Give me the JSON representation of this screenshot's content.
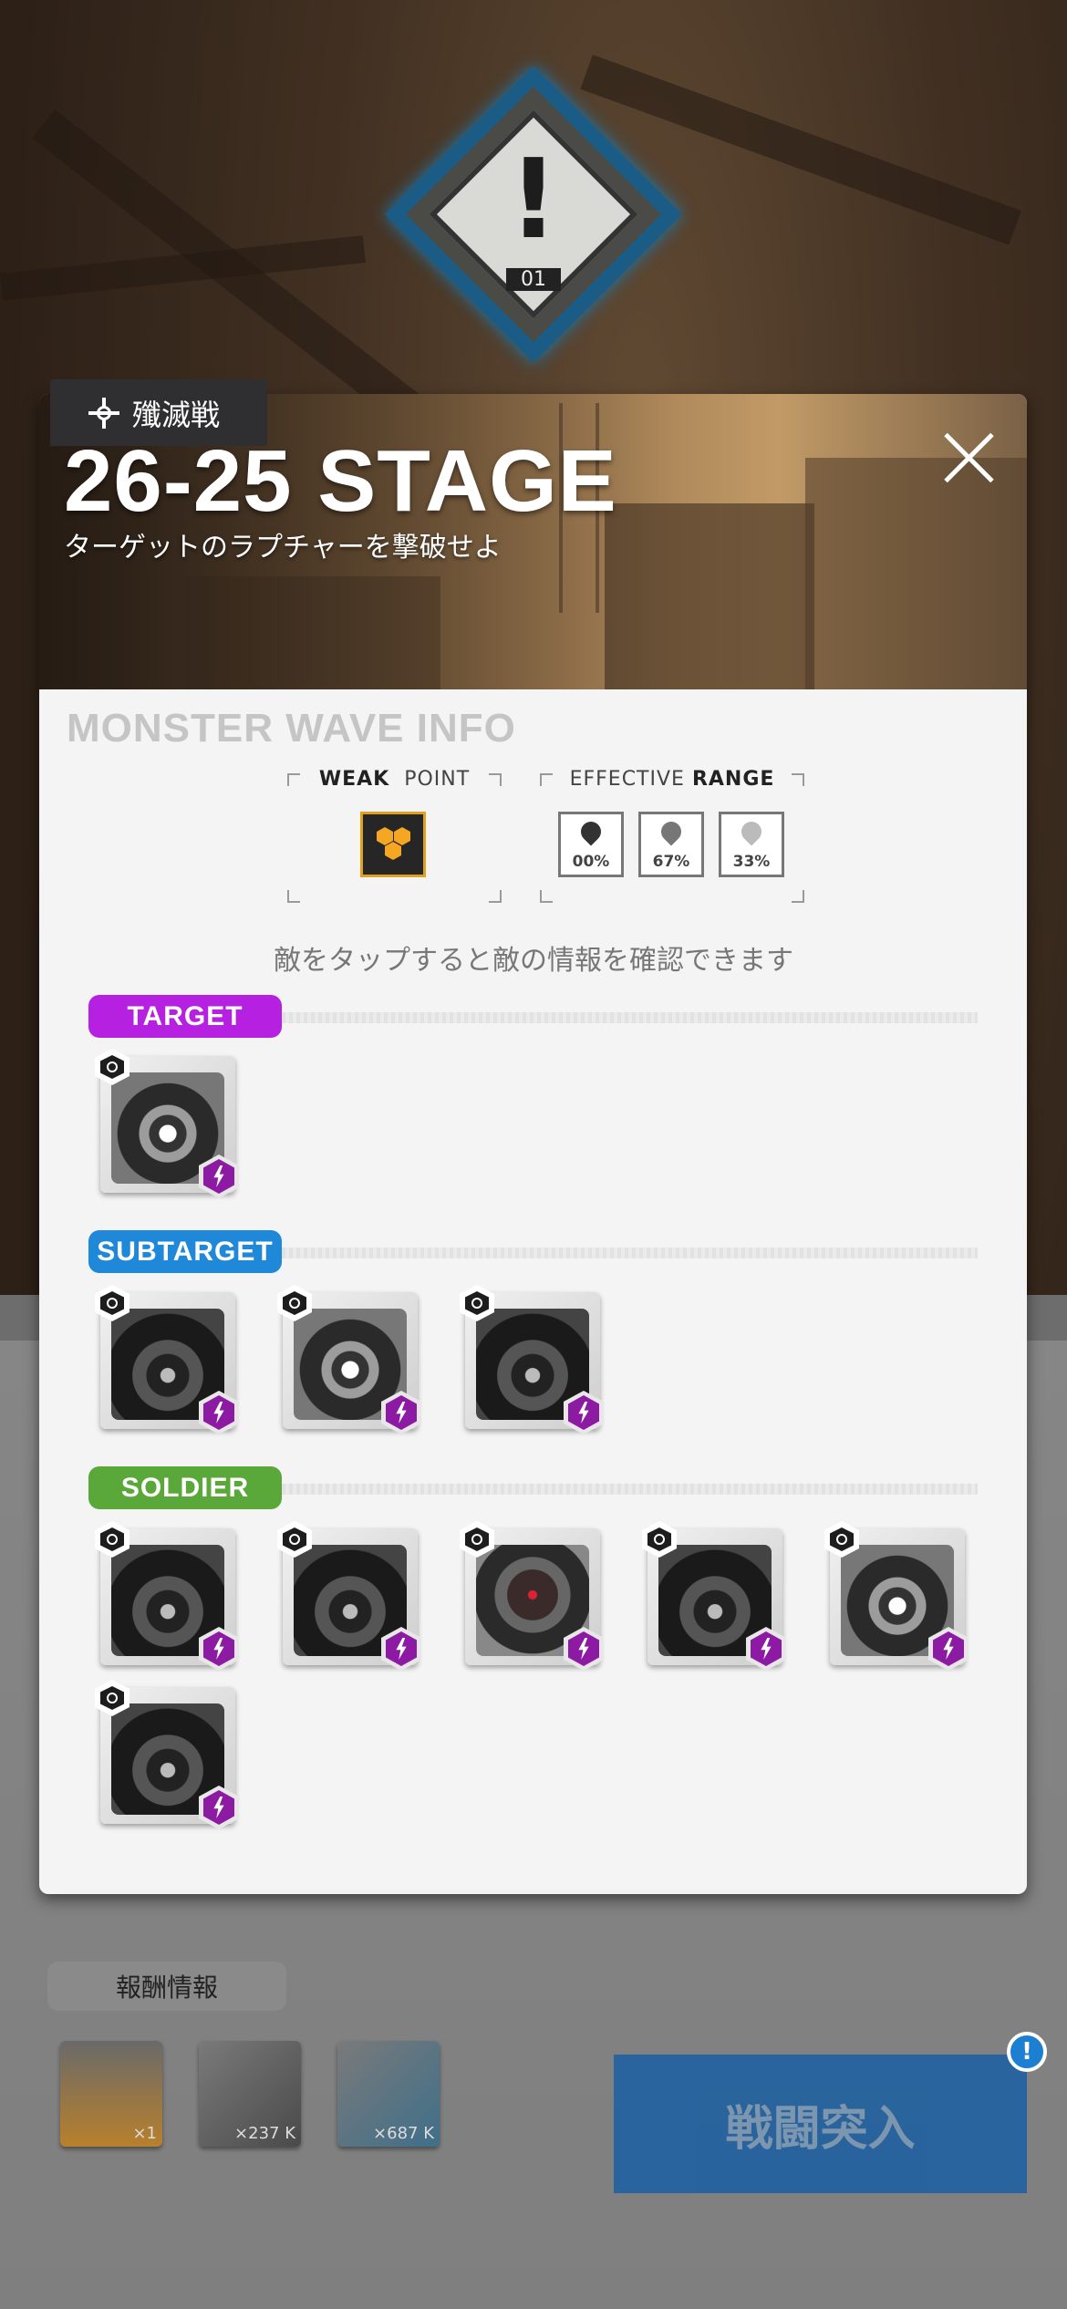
{
  "background": {
    "warning_icon": "warning-diamond-icon",
    "warning_number": "01"
  },
  "stage": {
    "mode_label": "殲滅戦",
    "title": "26-25 STAGE",
    "subtitle": "ターゲットのラプチャーを撃破せよ"
  },
  "wave_info": {
    "section_title": "MONSTER WAVE INFO",
    "weak_point": {
      "label_strong": "WEAK",
      "label_rest": "POINT",
      "icon": "honeycomb-icon",
      "color": "#f5a623"
    },
    "effective_range": {
      "label_rest": "EFFECTIVE",
      "label_strong": "RANGE",
      "tiles": [
        {
          "value": "00%"
        },
        {
          "value": "67%"
        },
        {
          "value": "33%"
        }
      ]
    },
    "hint": "敵をタップすると敵の情報を確認できます"
  },
  "categories": {
    "target": {
      "label": "TARGET",
      "color": "#b620e0"
    },
    "subtarget": {
      "label": "SUBTARGET",
      "color": "#1f88d8"
    },
    "soldier": {
      "label": "SOLDIER",
      "color": "#5aa83a"
    }
  },
  "footer": {
    "reward_title": "報酬情報",
    "rewards": [
      {
        "count": "×1"
      },
      {
        "count": "×237 K"
      },
      {
        "count": "×687 K"
      }
    ],
    "battle_button": "戦闘突入",
    "notice": "!"
  }
}
